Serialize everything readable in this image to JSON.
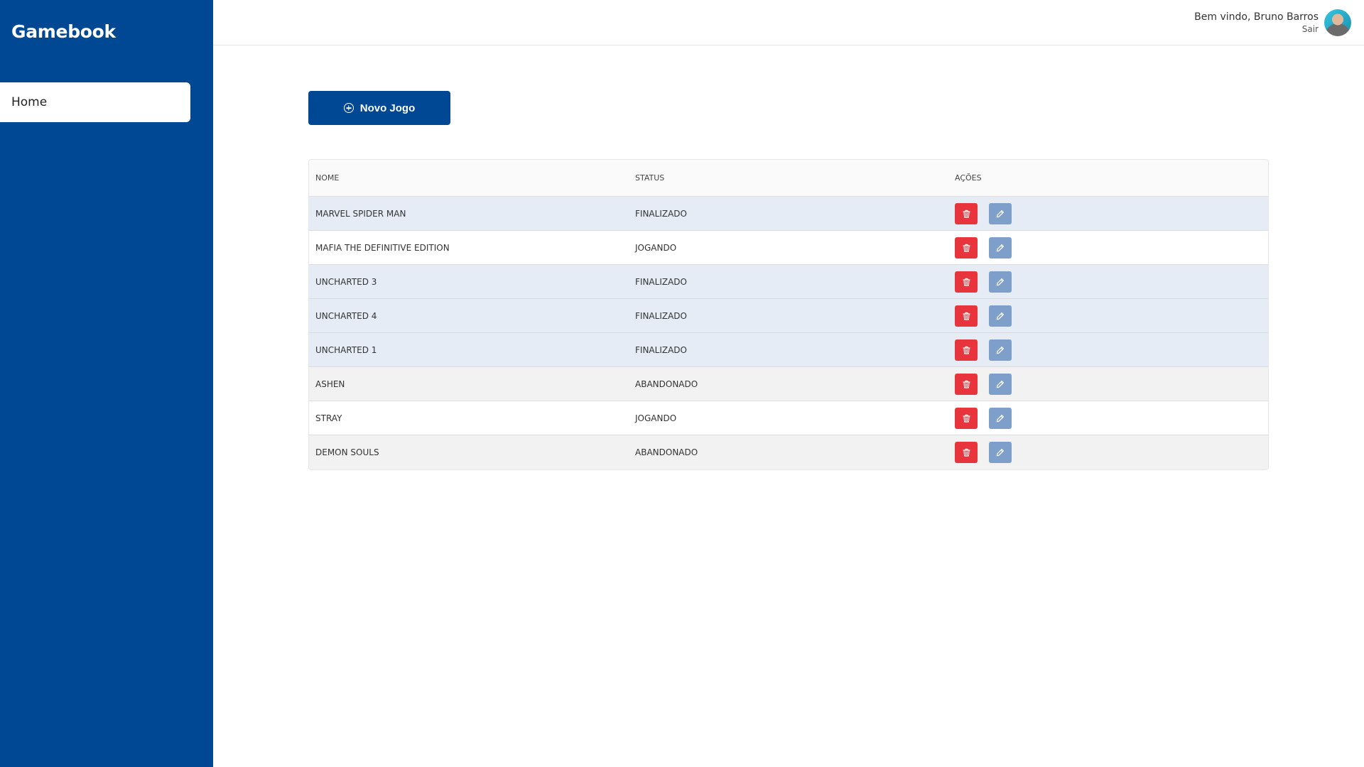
{
  "app": {
    "brand": "Gamebook"
  },
  "sidebar": {
    "items": [
      {
        "label": "Home",
        "icon": "none",
        "active": true
      }
    ]
  },
  "header": {
    "welcome": "Bem vindo, Bruno Barros",
    "logout": "Sair",
    "avatar": "user-avatar"
  },
  "main": {
    "new_game_label": "Novo Jogo",
    "new_game_icon": "plus-circle-icon",
    "table": {
      "columns": [
        "NOME",
        "STATUS",
        "AÇÕES"
      ],
      "rows": [
        {
          "name": "MARVEL SPIDER MAN",
          "status": "FINALIZADO"
        },
        {
          "name": "MAFIA THE DEFINITIVE EDITION",
          "status": "JOGANDO"
        },
        {
          "name": "UNCHARTED 3",
          "status": "FINALIZADO"
        },
        {
          "name": "UNCHARTED 4",
          "status": "FINALIZADO"
        },
        {
          "name": "UNCHARTED 1",
          "status": "FINALIZADO"
        },
        {
          "name": "ASHEN",
          "status": "ABANDONADO"
        },
        {
          "name": "STRAY",
          "status": "JOGANDO"
        },
        {
          "name": "DEMON SOULS",
          "status": "ABANDONADO"
        }
      ],
      "row_actions": [
        {
          "icon": "trash-icon"
        },
        {
          "icon": "pencil-icon"
        }
      ]
    }
  },
  "colors": {
    "primary": "#004893",
    "finalizado_row": "#e6ecf5",
    "jogando_row": "#ffffff",
    "abandonado_row": "#f2f2f2",
    "delete_button": "#e8343c",
    "edit_button": "#7e9fca"
  }
}
